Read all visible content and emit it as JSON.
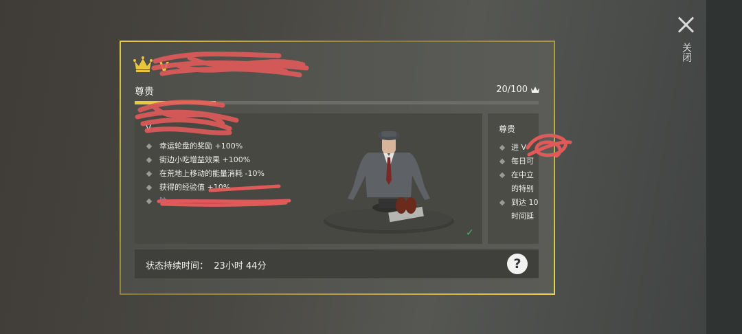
{
  "close": {
    "label": "关闭",
    "icon": "close-icon"
  },
  "panel": {
    "title_icon": "crown-icon",
    "title_prefix": "V",
    "tab_label": "尊贵",
    "count": "20/100",
    "count_icon": "crown-icon",
    "progress_fraction": 0.2,
    "accent_color": "#e5cb3f"
  },
  "main_card": {
    "heading_prefix": "V",
    "benefits": [
      "幸运轮盘的奖励 +100%",
      "街边小吃增益效果 +100%",
      "在荒地上移动的能量消耗 -10%",
      "获得的经验值 +10%",
      "独"
    ],
    "reward_check_icon": "check-icon"
  },
  "side_card": {
    "title": "尊贵",
    "lines": [
      "进 V",
      "每日可",
      "在中立",
      "的特别",
      "到达 10",
      "时间延"
    ]
  },
  "status": {
    "label": "状态持续时间：",
    "value": "23小时 44分",
    "help_label": "?"
  }
}
